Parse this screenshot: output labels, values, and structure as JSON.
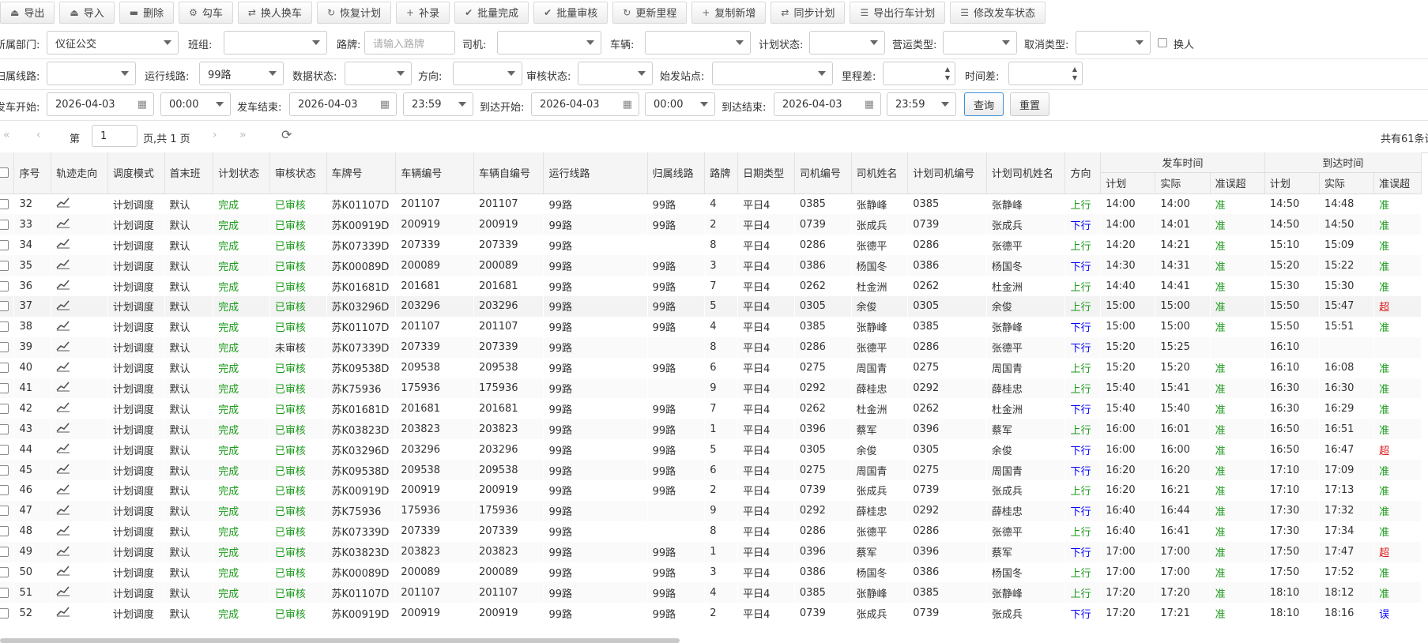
{
  "toolbar": [
    {
      "icon": "export-icon",
      "glyph": "⏏",
      "label": "导出"
    },
    {
      "icon": "import-icon",
      "glyph": "⏏",
      "label": "导入"
    },
    {
      "icon": "delete-icon",
      "glyph": "▬",
      "label": "删除"
    },
    {
      "icon": "cog-icon",
      "glyph": "⚙",
      "label": "勾车"
    },
    {
      "icon": "swap-icon",
      "glyph": "⇄",
      "label": "换人换车"
    },
    {
      "icon": "restore-icon",
      "glyph": "↻",
      "label": "恢复计划"
    },
    {
      "icon": "plus-icon",
      "glyph": "+",
      "label": "补录"
    },
    {
      "icon": "check-circle-icon",
      "glyph": "✔",
      "label": "批量完成"
    },
    {
      "icon": "check-circle-icon",
      "glyph": "✔",
      "label": "批量审核"
    },
    {
      "icon": "refresh-icon",
      "glyph": "↻",
      "label": "更新里程"
    },
    {
      "icon": "plus-icon",
      "glyph": "+",
      "label": "复制新增"
    },
    {
      "icon": "swap-icon",
      "glyph": "⇄",
      "label": "同步计划"
    },
    {
      "icon": "list-icon",
      "glyph": "☰",
      "label": "导出行车计划"
    },
    {
      "icon": "list-icon",
      "glyph": "☰",
      "label": "修改发车状态"
    }
  ],
  "filters": {
    "dept_label": "所属部门:",
    "dept_value": "仪征公交",
    "team_label": "班组:",
    "team_value": "",
    "plate_label": "路牌:",
    "plate_placeholder": "请输入路牌",
    "driver_label": "司机:",
    "driver_value": "",
    "vehicle_label": "车辆:",
    "vehicle_value": "",
    "plan_status_label": "计划状态:",
    "plan_status_value": "",
    "op_type_label": "营运类型:",
    "op_type_value": "",
    "cancel_type_label": "取消类型:",
    "cancel_type_value": "",
    "swap_label": "换人",
    "home_line_label": "归属线路:",
    "home_line_value": "",
    "run_line_label": "运行线路:",
    "run_line_value": "99路",
    "data_status_label": "数据状态:",
    "data_status_value": "",
    "direction_label": "方向:",
    "direction_value": "",
    "audit_status_label": "审核状态:",
    "audit_status_value": "",
    "start_station_label": "始发站点:",
    "start_station_value": "",
    "mileage_diff_label": "里程差:",
    "mileage_diff_value": "",
    "time_diff_label": "时间差:",
    "time_diff_value": "",
    "depart_start_label": "发车开始:",
    "depart_start_date": "2026-04-03",
    "depart_start_time": "00:00",
    "depart_end_label": "发车结束:",
    "depart_end_date": "2026-04-03",
    "depart_end_time": "23:59",
    "arrive_start_label": "到达开始:",
    "arrive_start_date": "2026-04-03",
    "arrive_start_time": "00:00",
    "arrive_end_label": "到达结束:",
    "arrive_end_date": "2026-04-03",
    "arrive_end_time": "23:59",
    "query_label": "查询",
    "reset_label": "重置"
  },
  "pager": {
    "page_prefix": "第",
    "page_value": "1",
    "page_suffix": "页,共 1 页",
    "total": "共有61条记"
  },
  "table": {
    "headers": [
      "序号",
      "轨迹走向",
      "调度模式",
      "首末班",
      "计划状态",
      "审核状态",
      "车牌号",
      "车辆编号",
      "车辆自编号",
      "运行线路",
      "归属线路",
      "路牌",
      "日期类型",
      "司机编号",
      "司机姓名",
      "计划司机编号",
      "计划司机姓名",
      "方向"
    ],
    "group_depart": "发车时间",
    "group_arrive": "到达时间",
    "sub_headers": [
      "计划",
      "实际",
      "准误超",
      "计划",
      "实际",
      "准误超"
    ],
    "rows": [
      [
        "32",
        "计划调度",
        "默认",
        "完成",
        "已审核",
        "苏K01107D",
        "201107",
        "201107",
        "99路",
        "99路",
        "4",
        "平日4",
        "0385",
        "张静峰",
        "0385",
        "张静峰",
        "上行",
        "14:00",
        "14:00",
        "准",
        "14:50",
        "14:48",
        "准"
      ],
      [
        "33",
        "计划调度",
        "默认",
        "完成",
        "已审核",
        "苏K00919D",
        "200919",
        "200919",
        "99路",
        "99路",
        "2",
        "平日4",
        "0739",
        "张成兵",
        "0739",
        "张成兵",
        "下行",
        "14:00",
        "14:01",
        "准",
        "14:50",
        "14:50",
        "准"
      ],
      [
        "34",
        "计划调度",
        "默认",
        "完成",
        "已审核",
        "苏K07339D",
        "207339",
        "207339",
        "99路",
        "",
        "8",
        "平日4",
        "0286",
        "张德平",
        "0286",
        "张德平",
        "上行",
        "14:20",
        "14:21",
        "准",
        "15:10",
        "15:09",
        "准"
      ],
      [
        "35",
        "计划调度",
        "默认",
        "完成",
        "已审核",
        "苏K00089D",
        "200089",
        "200089",
        "99路",
        "99路",
        "3",
        "平日4",
        "0386",
        "杨国冬",
        "0386",
        "杨国冬",
        "下行",
        "14:30",
        "14:31",
        "准",
        "15:20",
        "15:22",
        "准"
      ],
      [
        "36",
        "计划调度",
        "默认",
        "完成",
        "已审核",
        "苏K01681D",
        "201681",
        "201681",
        "99路",
        "99路",
        "7",
        "平日4",
        "0262",
        "杜金洲",
        "0262",
        "杜金洲",
        "上行",
        "14:40",
        "14:41",
        "准",
        "15:30",
        "15:30",
        "准"
      ],
      [
        "37",
        "计划调度",
        "默认",
        "完成",
        "已审核",
        "苏K03296D",
        "203296",
        "203296",
        "99路",
        "99路",
        "5",
        "平日4",
        "0305",
        "余俊",
        "0305",
        "余俊",
        "上行",
        "15:00",
        "15:00",
        "准",
        "15:50",
        "15:47",
        "超"
      ],
      [
        "38",
        "计划调度",
        "默认",
        "完成",
        "已审核",
        "苏K01107D",
        "201107",
        "201107",
        "99路",
        "99路",
        "4",
        "平日4",
        "0385",
        "张静峰",
        "0385",
        "张静峰",
        "下行",
        "15:00",
        "15:00",
        "准",
        "15:50",
        "15:51",
        "准"
      ],
      [
        "39",
        "计划调度",
        "默认",
        "完成",
        "未审核",
        "苏K07339D",
        "207339",
        "207339",
        "99路",
        "",
        "8",
        "平日4",
        "0286",
        "张德平",
        "0286",
        "张德平",
        "下行",
        "15:20",
        "15:25",
        "",
        "16:10",
        "",
        ""
      ],
      [
        "40",
        "计划调度",
        "默认",
        "完成",
        "已审核",
        "苏K09538D",
        "209538",
        "209538",
        "99路",
        "99路",
        "6",
        "平日4",
        "0275",
        "周国青",
        "0275",
        "周国青",
        "上行",
        "15:20",
        "15:20",
        "准",
        "16:10",
        "16:08",
        "准"
      ],
      [
        "41",
        "计划调度",
        "默认",
        "完成",
        "已审核",
        "苏K75936",
        "175936",
        "175936",
        "99路",
        "",
        "9",
        "平日4",
        "0292",
        "薛桂忠",
        "0292",
        "薛桂忠",
        "上行",
        "15:40",
        "15:41",
        "准",
        "16:30",
        "16:30",
        "准"
      ],
      [
        "42",
        "计划调度",
        "默认",
        "完成",
        "已审核",
        "苏K01681D",
        "201681",
        "201681",
        "99路",
        "99路",
        "7",
        "平日4",
        "0262",
        "杜金洲",
        "0262",
        "杜金洲",
        "下行",
        "15:40",
        "15:40",
        "准",
        "16:30",
        "16:29",
        "准"
      ],
      [
        "43",
        "计划调度",
        "默认",
        "完成",
        "已审核",
        "苏K03823D",
        "203823",
        "203823",
        "99路",
        "99路",
        "1",
        "平日4",
        "0396",
        "蔡军",
        "0396",
        "蔡军",
        "上行",
        "16:00",
        "16:01",
        "准",
        "16:50",
        "16:51",
        "准"
      ],
      [
        "44",
        "计划调度",
        "默认",
        "完成",
        "已审核",
        "苏K03296D",
        "203296",
        "203296",
        "99路",
        "99路",
        "5",
        "平日4",
        "0305",
        "余俊",
        "0305",
        "余俊",
        "下行",
        "16:00",
        "16:00",
        "准",
        "16:50",
        "16:47",
        "超"
      ],
      [
        "45",
        "计划调度",
        "默认",
        "完成",
        "已审核",
        "苏K09538D",
        "209538",
        "209538",
        "99路",
        "99路",
        "6",
        "平日4",
        "0275",
        "周国青",
        "0275",
        "周国青",
        "下行",
        "16:20",
        "16:20",
        "准",
        "17:10",
        "17:09",
        "准"
      ],
      [
        "46",
        "计划调度",
        "默认",
        "完成",
        "已审核",
        "苏K00919D",
        "200919",
        "200919",
        "99路",
        "99路",
        "2",
        "平日4",
        "0739",
        "张成兵",
        "0739",
        "张成兵",
        "上行",
        "16:20",
        "16:21",
        "准",
        "17:10",
        "17:13",
        "准"
      ],
      [
        "47",
        "计划调度",
        "默认",
        "完成",
        "已审核",
        "苏K75936",
        "175936",
        "175936",
        "99路",
        "",
        "9",
        "平日4",
        "0292",
        "薛桂忠",
        "0292",
        "薛桂忠",
        "下行",
        "16:40",
        "16:44",
        "准",
        "17:30",
        "17:32",
        "准"
      ],
      [
        "48",
        "计划调度",
        "默认",
        "完成",
        "已审核",
        "苏K07339D",
        "207339",
        "207339",
        "99路",
        "",
        "8",
        "平日4",
        "0286",
        "张德平",
        "0286",
        "张德平",
        "上行",
        "16:40",
        "16:41",
        "准",
        "17:30",
        "17:34",
        "准"
      ],
      [
        "49",
        "计划调度",
        "默认",
        "完成",
        "已审核",
        "苏K03823D",
        "203823",
        "203823",
        "99路",
        "99路",
        "1",
        "平日4",
        "0396",
        "蔡军",
        "0396",
        "蔡军",
        "下行",
        "17:00",
        "17:00",
        "准",
        "17:50",
        "17:47",
        "超"
      ],
      [
        "50",
        "计划调度",
        "默认",
        "完成",
        "已审核",
        "苏K00089D",
        "200089",
        "200089",
        "99路",
        "99路",
        "3",
        "平日4",
        "0386",
        "杨国冬",
        "0386",
        "杨国冬",
        "上行",
        "17:00",
        "17:00",
        "准",
        "17:50",
        "17:52",
        "准"
      ],
      [
        "51",
        "计划调度",
        "默认",
        "完成",
        "已审核",
        "苏K01107D",
        "201107",
        "201107",
        "99路",
        "99路",
        "4",
        "平日4",
        "0385",
        "张静峰",
        "0385",
        "张静峰",
        "上行",
        "17:20",
        "17:20",
        "准",
        "18:10",
        "18:12",
        "准"
      ],
      [
        "52",
        "计划调度",
        "默认",
        "完成",
        "已审核",
        "苏K00919D",
        "200919",
        "200919",
        "99路",
        "99路",
        "2",
        "平日4",
        "0739",
        "张成兵",
        "0739",
        "张成兵",
        "下行",
        "17:20",
        "17:21",
        "准",
        "18:10",
        "18:16",
        "误"
      ]
    ]
  }
}
